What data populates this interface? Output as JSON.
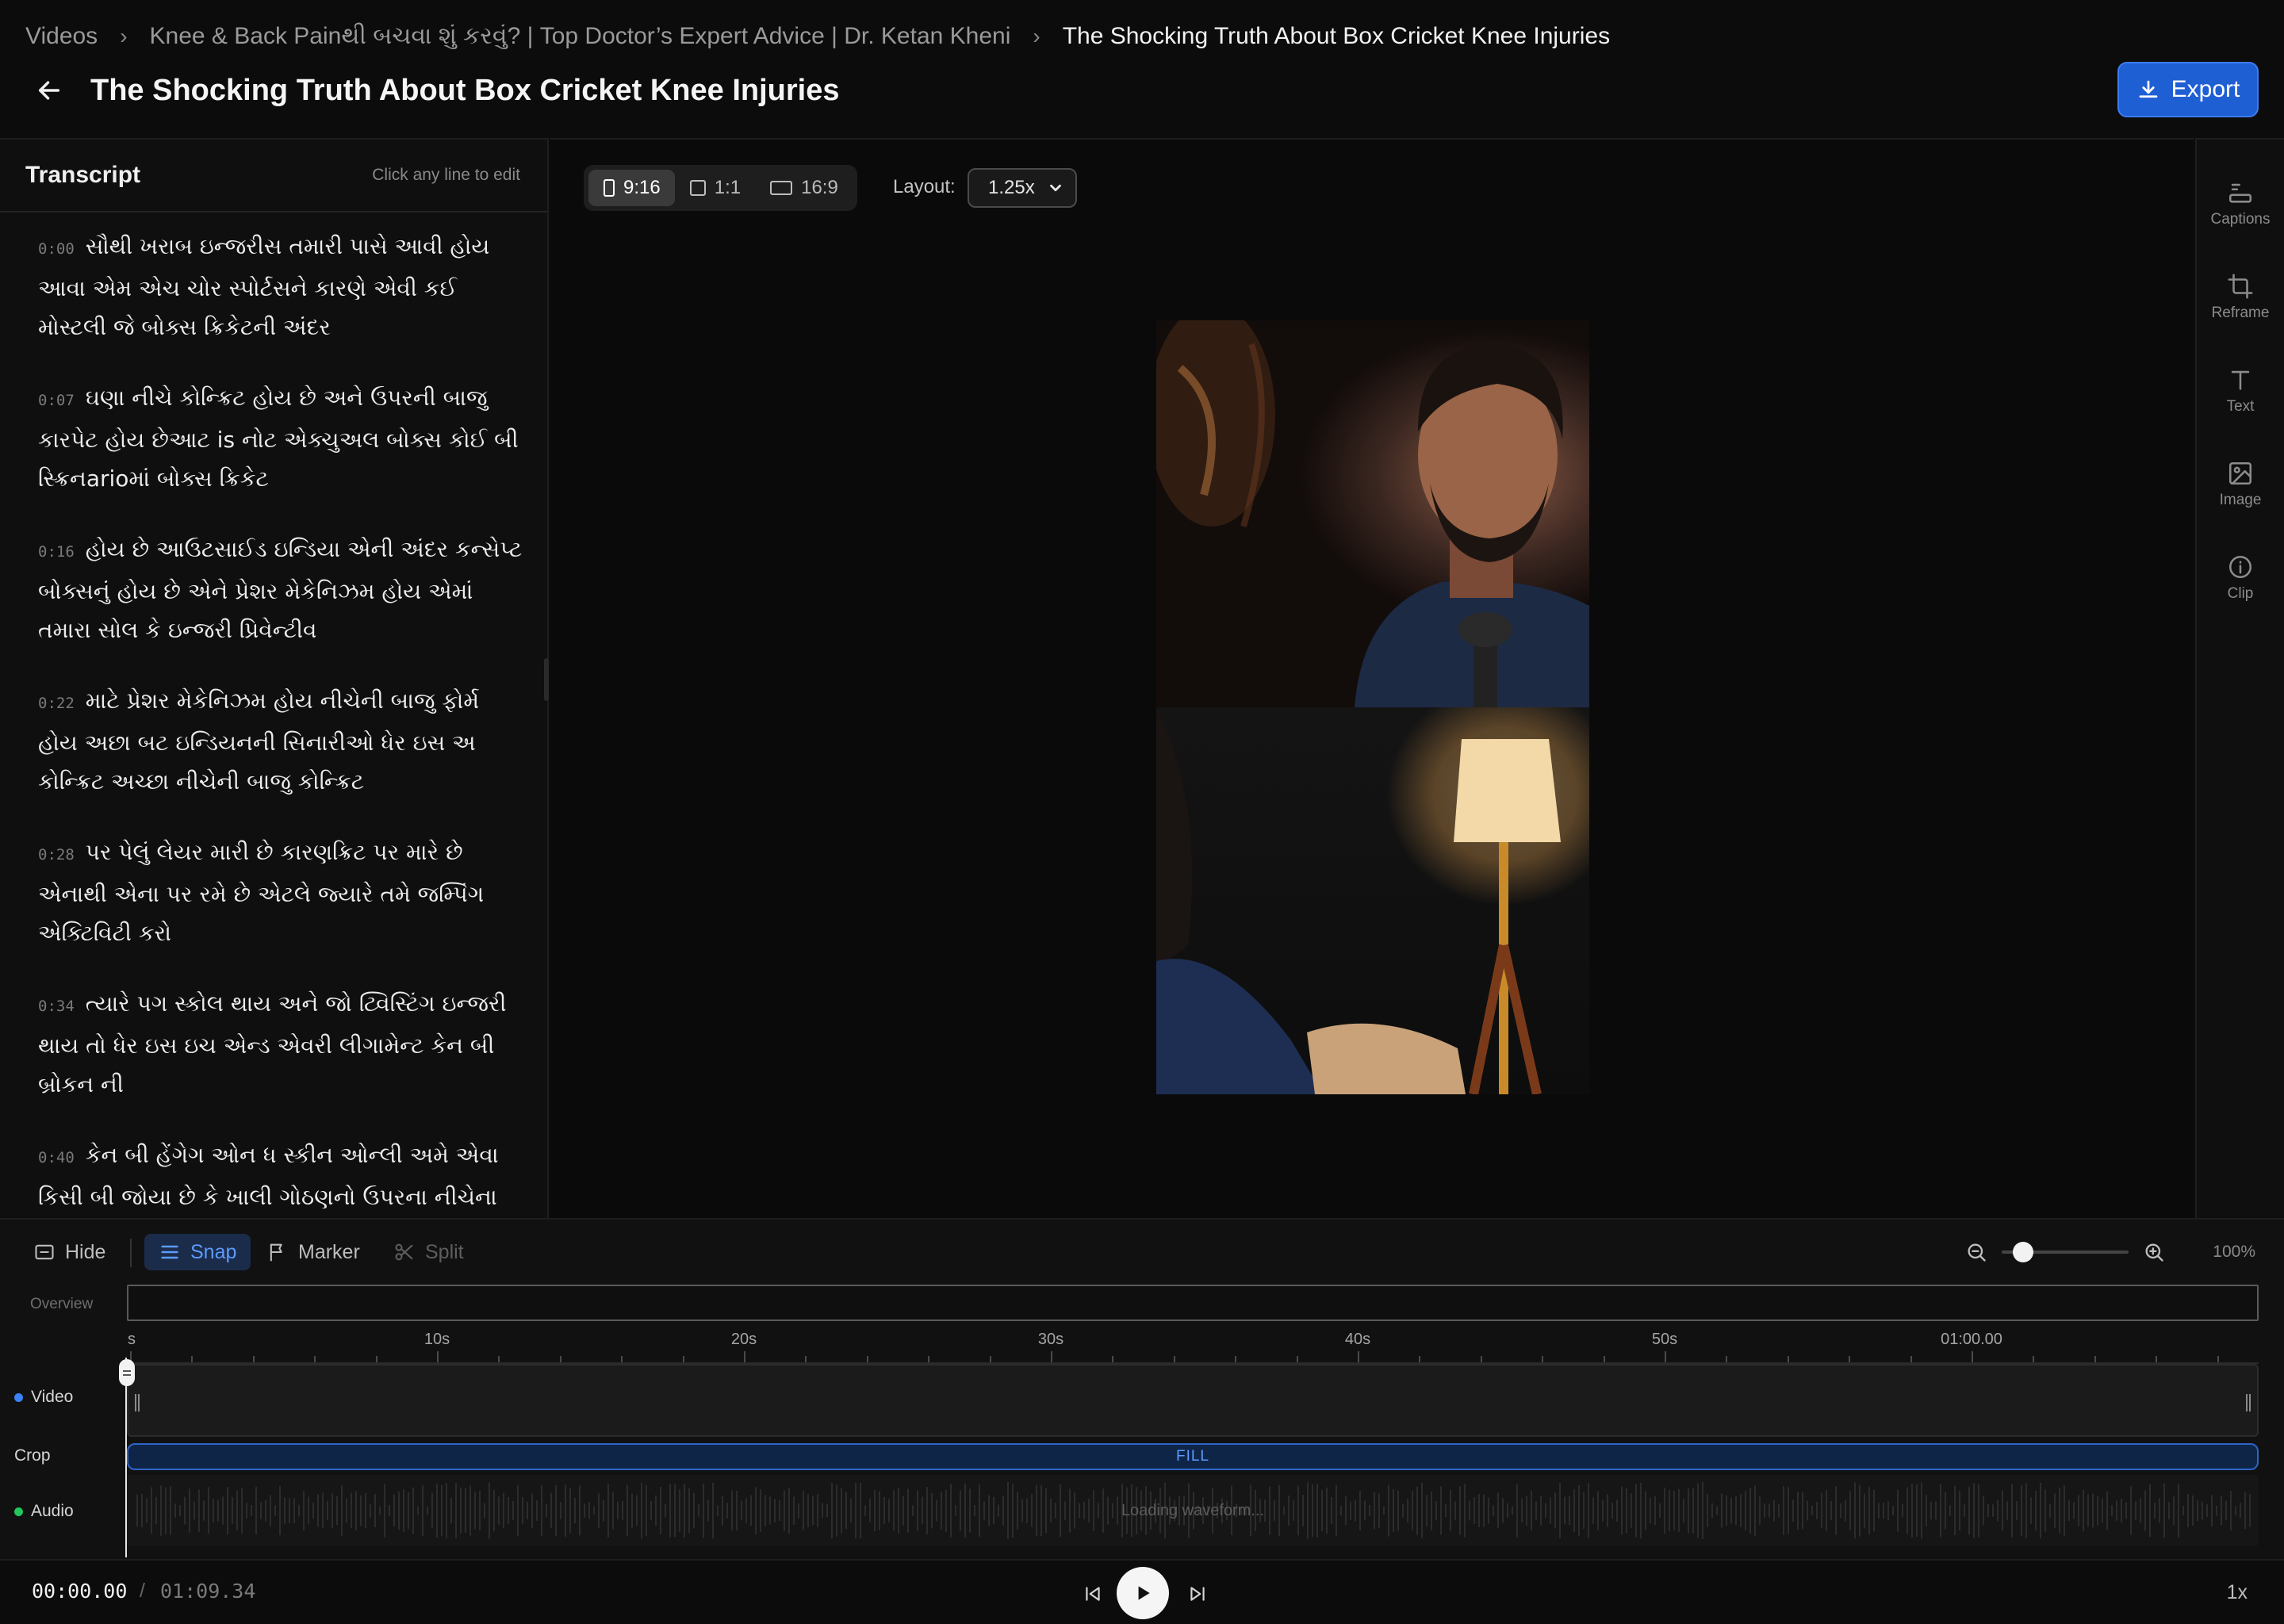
{
  "breadcrumb": {
    "items": [
      "Videos",
      "Knee & Back Painથી બચવા શું કરવું? | Top Doctor’s Expert Advice | Dr. Ketan Kheni",
      "The Shocking Truth About Box Cricket Knee Injuries"
    ]
  },
  "header": {
    "title": "The Shocking Truth About Box Cricket Knee Injuries",
    "export_label": "Export"
  },
  "transcript": {
    "title": "Transcript",
    "hint": "Click any line to edit",
    "lines": [
      {
        "time": "0:00",
        "text": "સૌથી ખરાબ ઇન્જરીસ તમારી પાસે આવી હોય આવા એમ એચ ચોર સ્પોર્ટસને કારણે એવી કઈ મોસ્ટલી જે બોક્સ ક્રિકેટની અંદર"
      },
      {
        "time": "0:07",
        "text": "ઘણા નીચે કોન્ક્રિટ હોય છે અને ઉપરની બાજુ કારપેટ હોય છેઆટ is નોટ એક્ચુઅલ બોક્સ કોઈ બી સ્ક્રિનarioમાં બોક્સ ક્રિકેટ"
      },
      {
        "time": "0:16",
        "text": "હોય છે આઉટસાઈડ ઇન્ડિયા એની અંદર કન્સેપ્ટ બોક્સનું હોય છે એને પ્રેશર મેકેનિઝમ હોય એમાં તમારા સોલ કે ઇન્જરી પ્રિવેન્ટીવ"
      },
      {
        "time": "0:22",
        "text": "માટે પ્રેશર મેકેનિઝમ હોય નીચેની બાજુ ફોર્મ હોય અછા બટ ઇન્ડિયનની સિનારીઓ ધેર ઇસ અ કોન્ક્રિટ અચ્છા નીચેની બાજુ કોન્ક્રિટ"
      },
      {
        "time": "0:28",
        "text": "પર પેલું લેયર મારી છે કારણક્રિટ પર મારે છે એનાથી એના પર રમે છે એટલે જ્યારે તમે જમ્પિંગ એક્ટિવિટી કરો"
      },
      {
        "time": "0:34",
        "text": "ત્યારે પગ સ્કોલ થાય અને જો ટ્વિસ્ટિંગ ઇન્જરી થાય તો ધેર ઇસ ઇચ એન્ડ એવરી લીગામેન્ટ કેન બી બ્રોકન ની"
      },
      {
        "time": "0:40",
        "text": "કેન બી હેંગેગ ઓન ધ સ્કીન ઓન્લી અમે એવા કિસી બી જોયા છે કે ખાલી ગોઠણનો ઉપરના નીચેના"
      }
    ]
  },
  "canvas": {
    "aspects": [
      {
        "label": "9:16",
        "active": true
      },
      {
        "label": "1:1",
        "active": false
      },
      {
        "label": "16:9",
        "active": false
      }
    ],
    "layout_label": "Layout:",
    "layout_value": "1.25x"
  },
  "tools": [
    {
      "label": "Captions",
      "icon": "captions-icon"
    },
    {
      "label": "Reframe",
      "icon": "crop-icon"
    },
    {
      "label": "Text",
      "icon": "text-icon"
    },
    {
      "label": "Image",
      "icon": "image-icon"
    },
    {
      "label": "Clip",
      "icon": "info-icon"
    }
  ],
  "timeline": {
    "hide_label": "Hide",
    "snap_label": "Snap",
    "marker_label": "Marker",
    "split_label": "Split",
    "zoom_level": "100%",
    "zoom_fraction": 0.1,
    "overview_label": "Overview",
    "ruler": [
      {
        "label": "s",
        "seconds": 0
      },
      {
        "label": "10s",
        "seconds": 10
      },
      {
        "label": "20s",
        "seconds": 20
      },
      {
        "label": "30s",
        "seconds": 30
      },
      {
        "label": "40s",
        "seconds": 40
      },
      {
        "label": "50s",
        "seconds": 50
      },
      {
        "label": "01:00.00",
        "seconds": 60
      }
    ],
    "duration_seconds": 69.34,
    "tracks": {
      "video_label": "Video",
      "crop_label": "Crop",
      "crop_value": "FILL",
      "audio_label": "Audio",
      "audio_status": "Loading waveform..."
    },
    "colors": {
      "video_dot": "#3b82f6",
      "audio_dot": "#22c55e",
      "accent": "#1f5fd4"
    }
  },
  "transport": {
    "current_time": "00:00.00",
    "separator": "/",
    "total_time": "01:09.34",
    "speed": "1x"
  }
}
